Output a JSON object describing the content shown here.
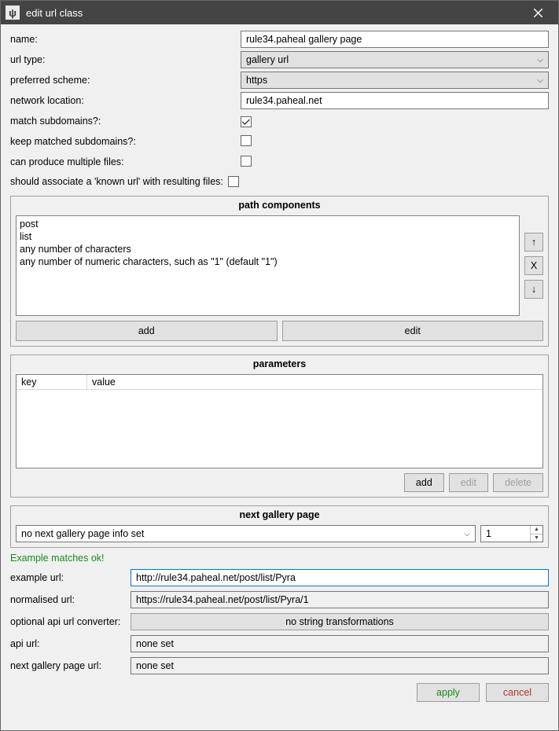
{
  "titlebar": {
    "icon_glyph": "ψ",
    "title": "edit url class"
  },
  "fields": {
    "name_label": "name:",
    "name_value": "rule34.paheal gallery page",
    "url_type_label": "url type:",
    "url_type_value": "gallery url",
    "scheme_label": "preferred scheme:",
    "scheme_value": "https",
    "netloc_label": "network location:",
    "netloc_value": "rule34.paheal.net",
    "match_sub_label": "match subdomains?:",
    "match_sub_checked": true,
    "keep_sub_label": "keep matched subdomains?:",
    "keep_sub_checked": false,
    "multi_files_label": "can produce multiple files:",
    "multi_files_checked": false,
    "assoc_label": "should associate a 'known url' with resulting files:",
    "assoc_checked": false
  },
  "path": {
    "header": "path components",
    "items": [
      "post",
      "list",
      "any number of characters",
      "any number of numeric characters, such as \"1\" (default \"1\")"
    ],
    "up": "↑",
    "x": "X",
    "down": "↓",
    "add": "add",
    "edit": "edit"
  },
  "params": {
    "header": "parameters",
    "col_key": "key",
    "col_value": "value",
    "add": "add",
    "edit": "edit",
    "delete": "delete"
  },
  "ngp": {
    "header": "next gallery page",
    "select_value": "no next gallery page info set",
    "spin_value": "1"
  },
  "status": "Example matches ok!",
  "example": {
    "example_label": "example url:",
    "example_value": "http://rule34.paheal.net/post/list/Pyra",
    "normalised_label": "normalised url:",
    "normalised_value": "https://rule34.paheal.net/post/list/Pyra/1",
    "api_converter_label": "optional api url converter:",
    "api_converter_button": "no string transformations",
    "api_url_label": "api url:",
    "api_url_value": "none set",
    "ngp_url_label": "next gallery page url:",
    "ngp_url_value": "none set"
  },
  "footer": {
    "apply": "apply",
    "cancel": "cancel"
  }
}
